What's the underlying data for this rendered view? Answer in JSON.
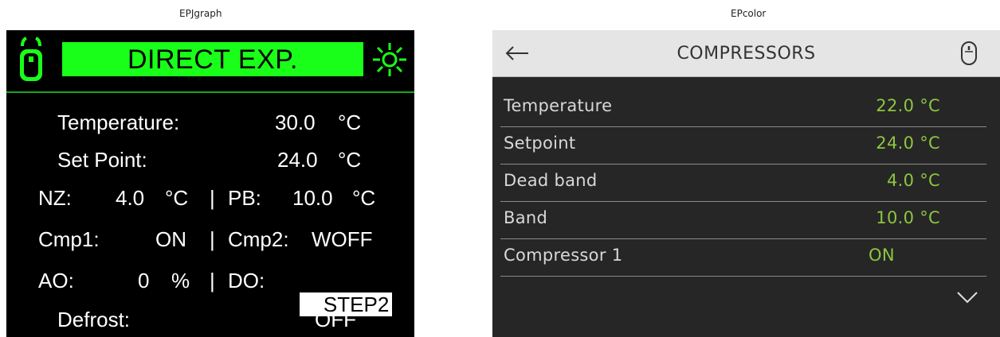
{
  "captions": {
    "left": "EPJgraph",
    "right": "EPcolor"
  },
  "colors": {
    "lcd_accent": "#1aff1a",
    "value_green": "#8dc63f",
    "panel_dark": "#262626",
    "topbar": "#e5e5e5"
  },
  "epjgraph": {
    "title": "DIRECT EXP.",
    "icons": [
      "mouse-icon",
      "sun-icon"
    ],
    "temperature": {
      "label": "Temperature:",
      "value": "30.0",
      "unit": "°C"
    },
    "set_point": {
      "label": "Set Point:",
      "value": "24.0",
      "unit": "°C"
    },
    "nz": {
      "label": "NZ:",
      "value": "4.0",
      "unit": "°C"
    },
    "pb": {
      "label": "PB:",
      "value": "10.0",
      "unit": "°C"
    },
    "cmp1": {
      "label": "Cmp1:",
      "value": "ON"
    },
    "cmp2": {
      "label": "Cmp2:",
      "value": "WOFF"
    },
    "ao": {
      "label": "AO:",
      "value": "0",
      "unit": "%"
    },
    "do": {
      "label": "DO:",
      "value": "STEP2"
    },
    "defrost": {
      "label": "Defrost:",
      "value": "OFF"
    },
    "separator": "|"
  },
  "epcolor": {
    "title": "COMPRESSORS",
    "icons": [
      "back-arrow-icon",
      "mouse-icon",
      "chevron-down-icon"
    ],
    "rows": [
      {
        "label": "Temperature",
        "value": "22.0 °C"
      },
      {
        "label": "Setpoint",
        "value": "24.0 °C"
      },
      {
        "label": "Dead band",
        "value": "4.0 °C"
      },
      {
        "label": "Band",
        "value": "10.0 °C"
      },
      {
        "label": "Compressor 1",
        "value": "ON"
      }
    ]
  }
}
